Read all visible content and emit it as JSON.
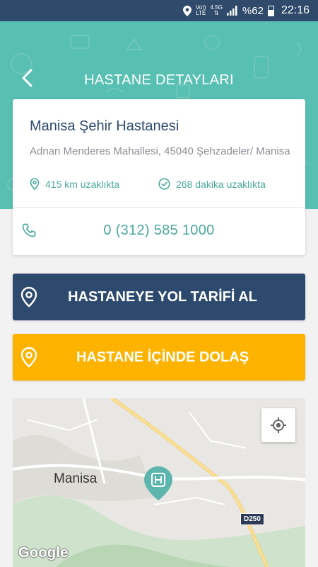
{
  "status_bar": {
    "network_top": "Vo))",
    "network_bottom": "LTE",
    "signal_top": "4.5G",
    "battery": "%62",
    "time": "22:16"
  },
  "header": {
    "title": "HASTANE DETAYLARI"
  },
  "hospital": {
    "name": "Manisa Şehir Hastanesi",
    "address": "Adnan Menderes Mahallesi, 45040 Şehzadeler/ Manisa",
    "distance": "415 km uzaklıkta",
    "duration": "268 dakika uzaklıkta",
    "phone": "0 (312) 585 1000"
  },
  "actions": {
    "directions_label": "HASTANEYE YOL TARİFİ AL",
    "indoor_label": "HASTANE İÇİNDE DOLAŞ"
  },
  "map": {
    "city_label": "Manisa",
    "road_label": "D250",
    "provider": "Google"
  },
  "colors": {
    "header_teal": "#58bfb3",
    "navy": "#2d4a6e",
    "accent_teal": "#4aa99f",
    "amber": "#fdb300"
  }
}
